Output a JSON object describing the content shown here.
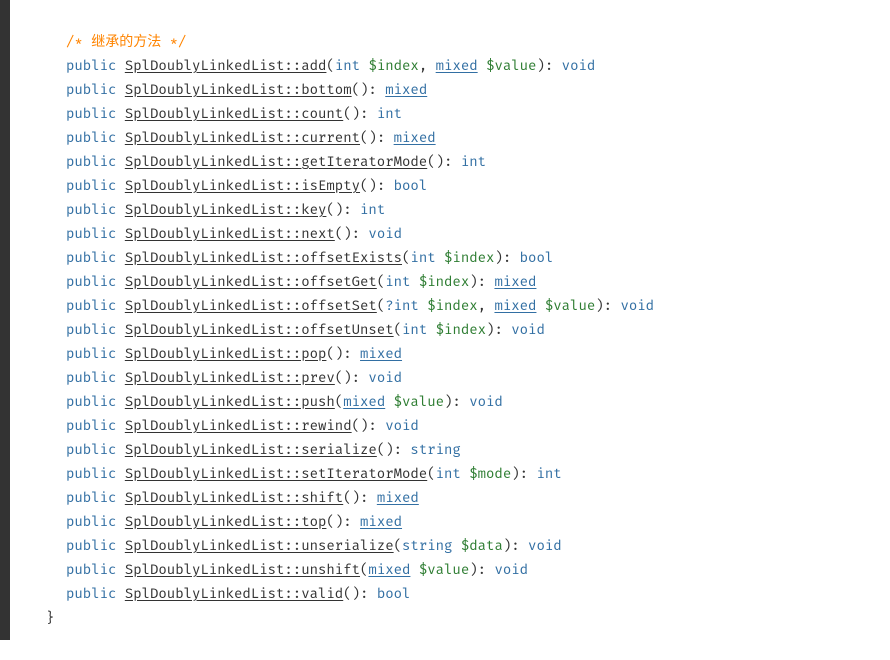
{
  "section_comment": "/* 继承的方法 */",
  "modifier": "public",
  "close_brace": "}",
  "methods": [
    {
      "name": "SplDoublyLinkedList::add",
      "params": [
        {
          "type": "int",
          "type_link": false,
          "name": "$index"
        },
        {
          "type": "mixed",
          "type_link": true,
          "name": "$value"
        }
      ],
      "return": "void",
      "return_link": false
    },
    {
      "name": "SplDoublyLinkedList::bottom",
      "params": [],
      "return": "mixed",
      "return_link": true
    },
    {
      "name": "SplDoublyLinkedList::count",
      "params": [],
      "return": "int",
      "return_link": false
    },
    {
      "name": "SplDoublyLinkedList::current",
      "params": [],
      "return": "mixed",
      "return_link": true
    },
    {
      "name": "SplDoublyLinkedList::getIteratorMode",
      "params": [],
      "return": "int",
      "return_link": false
    },
    {
      "name": "SplDoublyLinkedList::isEmpty",
      "params": [],
      "return": "bool",
      "return_link": false
    },
    {
      "name": "SplDoublyLinkedList::key",
      "params": [],
      "return": "int",
      "return_link": false
    },
    {
      "name": "SplDoublyLinkedList::next",
      "params": [],
      "return": "void",
      "return_link": false
    },
    {
      "name": "SplDoublyLinkedList::offsetExists",
      "params": [
        {
          "type": "int",
          "type_link": false,
          "name": "$index"
        }
      ],
      "return": "bool",
      "return_link": false
    },
    {
      "name": "SplDoublyLinkedList::offsetGet",
      "params": [
        {
          "type": "int",
          "type_link": false,
          "name": "$index"
        }
      ],
      "return": "mixed",
      "return_link": true
    },
    {
      "name": "SplDoublyLinkedList::offsetSet",
      "params": [
        {
          "type": "?int",
          "type_link": false,
          "name": "$index"
        },
        {
          "type": "mixed",
          "type_link": true,
          "name": "$value"
        }
      ],
      "return": "void",
      "return_link": false
    },
    {
      "name": "SplDoublyLinkedList::offsetUnset",
      "params": [
        {
          "type": "int",
          "type_link": false,
          "name": "$index"
        }
      ],
      "return": "void",
      "return_link": false
    },
    {
      "name": "SplDoublyLinkedList::pop",
      "params": [],
      "return": "mixed",
      "return_link": true
    },
    {
      "name": "SplDoublyLinkedList::prev",
      "params": [],
      "return": "void",
      "return_link": false
    },
    {
      "name": "SplDoublyLinkedList::push",
      "params": [
        {
          "type": "mixed",
          "type_link": true,
          "name": "$value"
        }
      ],
      "return": "void",
      "return_link": false
    },
    {
      "name": "SplDoublyLinkedList::rewind",
      "params": [],
      "return": "void",
      "return_link": false
    },
    {
      "name": "SplDoublyLinkedList::serialize",
      "params": [],
      "return": "string",
      "return_link": false
    },
    {
      "name": "SplDoublyLinkedList::setIteratorMode",
      "params": [
        {
          "type": "int",
          "type_link": false,
          "name": "$mode"
        }
      ],
      "return": "int",
      "return_link": false
    },
    {
      "name": "SplDoublyLinkedList::shift",
      "params": [],
      "return": "mixed",
      "return_link": true
    },
    {
      "name": "SplDoublyLinkedList::top",
      "params": [],
      "return": "mixed",
      "return_link": true
    },
    {
      "name": "SplDoublyLinkedList::unserialize",
      "params": [
        {
          "type": "string",
          "type_link": false,
          "name": "$data"
        }
      ],
      "return": "void",
      "return_link": false
    },
    {
      "name": "SplDoublyLinkedList::unshift",
      "params": [
        {
          "type": "mixed",
          "type_link": true,
          "name": "$value"
        }
      ],
      "return": "void",
      "return_link": false
    },
    {
      "name": "SplDoublyLinkedList::valid",
      "params": [],
      "return": "bool",
      "return_link": false
    }
  ]
}
